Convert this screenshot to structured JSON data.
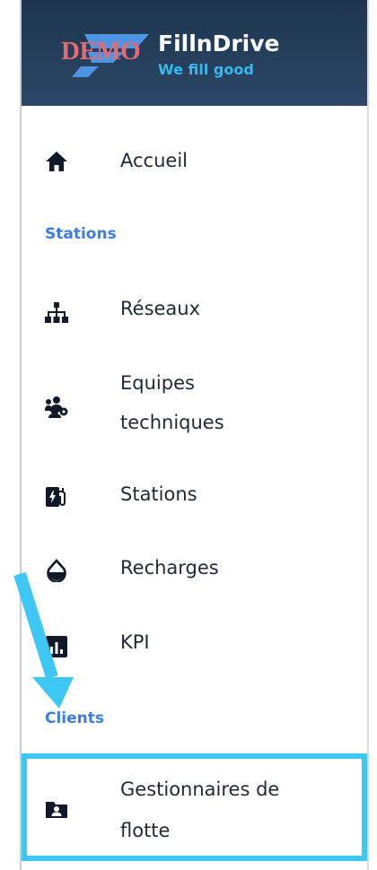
{
  "brand": {
    "demo_badge": "DEMO",
    "name": "FillnDrive",
    "tagline": "We fill good"
  },
  "nav": {
    "home": {
      "label": "Accueil",
      "icon": "home-icon"
    },
    "section_stations": "Stations",
    "networks": {
      "label": "Réseaux",
      "icon": "network-icon"
    },
    "tech_teams": {
      "label_line1": "Equipes",
      "label_line2": "techniques",
      "icon": "team-icon"
    },
    "stations": {
      "label": "Stations",
      "icon": "charging-station-icon"
    },
    "recharges": {
      "label": "Recharges",
      "icon": "drop-icon"
    },
    "kpi": {
      "label": "KPI",
      "icon": "chart-icon"
    },
    "section_clients": "Clients",
    "fleet_managers": {
      "label_line1": "Gestionnaires de",
      "label_line2": "flotte",
      "icon": "folder-user-icon"
    }
  },
  "colors": {
    "header": "#1d3550",
    "section": "#3b7de0",
    "highlight": "#3cc7f4",
    "arrow": "#3cc7f4"
  }
}
